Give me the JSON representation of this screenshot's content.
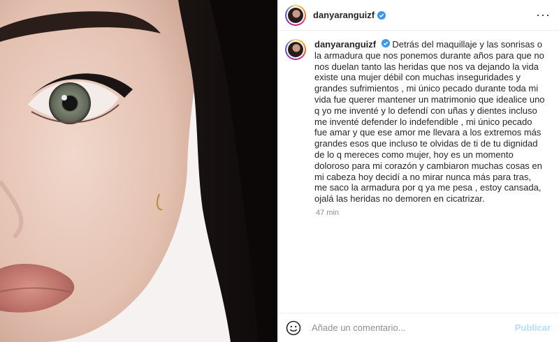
{
  "post": {
    "username": "danyaranguizf",
    "caption": "Detrás del maquillaje y las sonrisas o la armadura que nos ponemos durante años para que no nos duelan tanto las heridas que nos va dejando la vida existe una mujer débil con muchas inseguridades y grandes sufrimientos , mi único pecado durante toda mi vida fue querer mantener un matrimonio que idealice uno q yo me inventé y lo defendí con uñas y dientes incluso me inventé defender lo indefendible , mi único pecado fue amar y que ese amor me llevara a los extremos más grandes esos que incluso te olvidas de ti de tu dignidad de lo q mereces como mujer, hoy es un momento doloroso para mi corazón y cambiaron muchas cosas en mi cabeza hoy decidí a no mirar nunca más para tras, me saco la armadura por q ya me pesa , estoy cansada, ojalá las heridas no demoren en cicatrizar.",
    "time": "47 min"
  },
  "header": {
    "username": "danyaranguizf",
    "more_label": "···"
  },
  "composer": {
    "placeholder": "Añade un comentario...",
    "publish_label": "Publicar"
  },
  "colors": {
    "verified": "#3897f0",
    "publish_disabled": "#b2dffc"
  },
  "icons": [
    "verified-badge-icon",
    "more-options-icon",
    "emoji-icon"
  ]
}
